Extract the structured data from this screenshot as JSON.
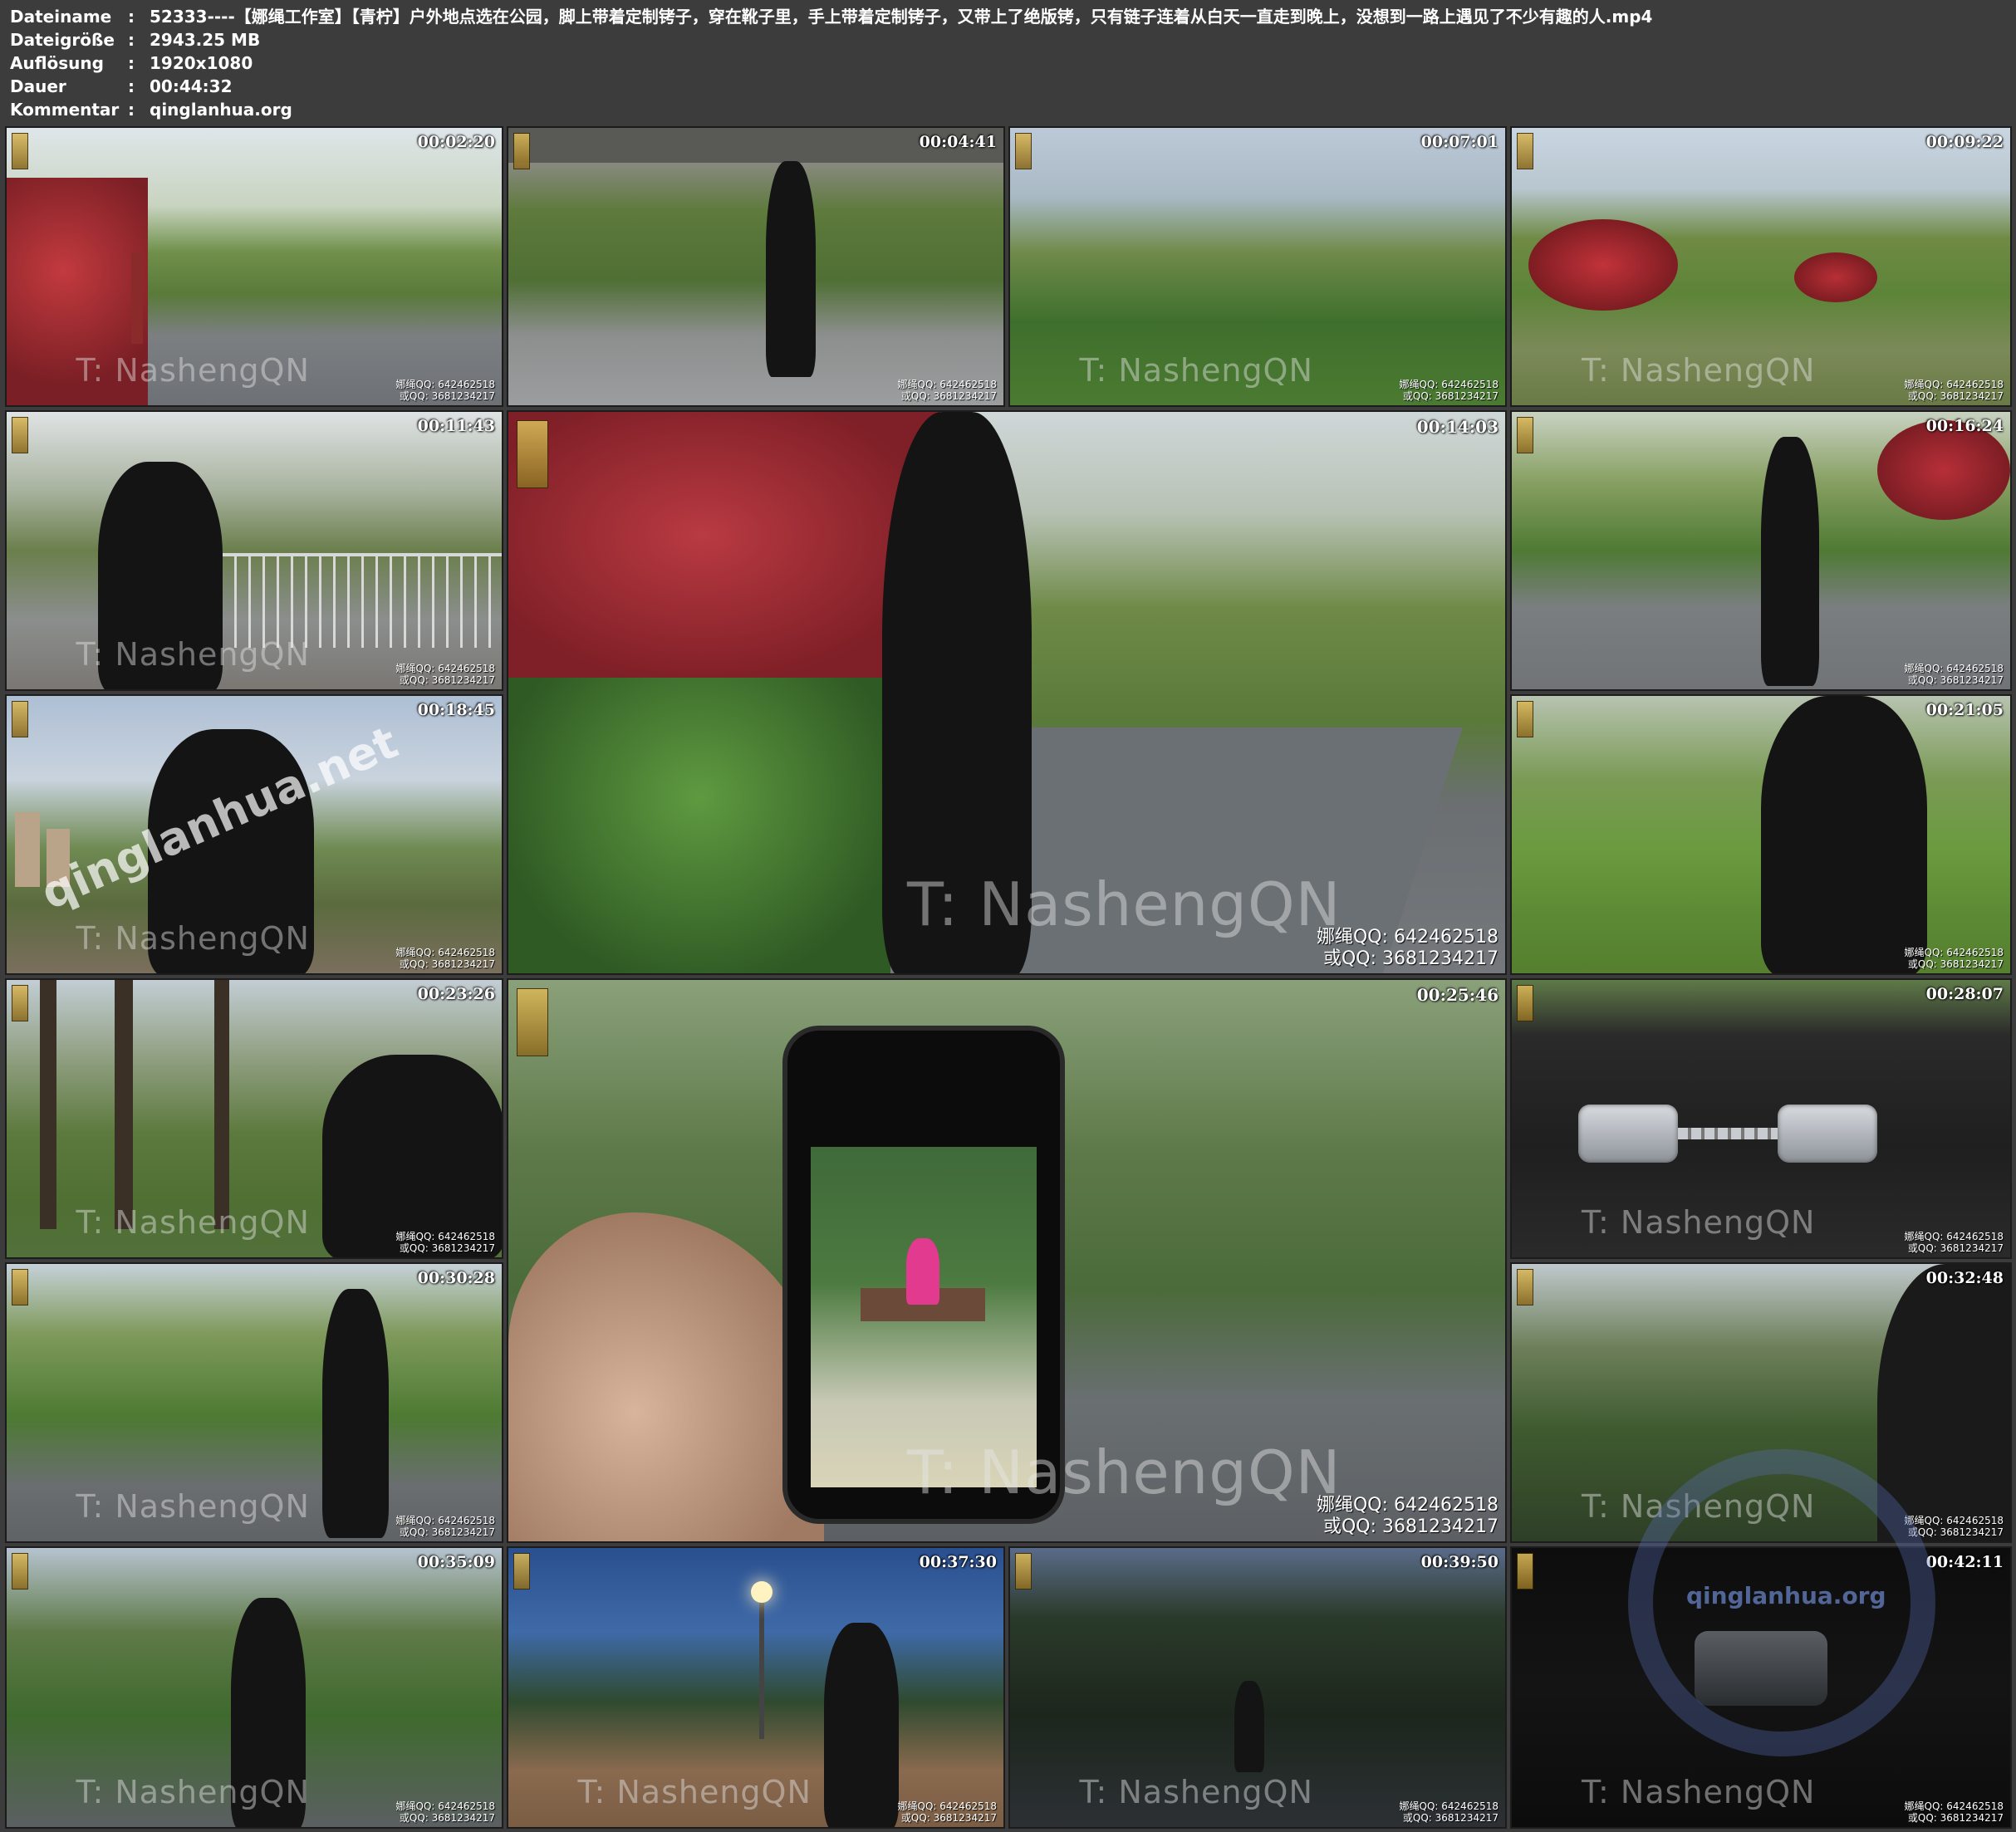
{
  "meta": {
    "rows": [
      {
        "key": "Dateiname",
        "value": "52333----【娜绳工作室】【青柠】户外地点选在公园，脚上带着定制铐子，穿在靴子里，手上带着定制铐子，又带上了绝版铐，只有链子连着从白天一直走到晚上，没想到一路上遇见了不少有趣的人.mp4"
      },
      {
        "key": "Dateigröße",
        "value": "2943.25 MB"
      },
      {
        "key": "Auflösung",
        "value": "1920x1080"
      },
      {
        "key": "Dauer",
        "value": "00:44:32"
      },
      {
        "key": "Kommentar",
        "value": "qinglanhua.org"
      }
    ],
    "separator": ":"
  },
  "watermark": {
    "frame_text": "T: NashengQN",
    "qq_line1": "娜绳QQ: 642462518",
    "qq_line2": "或QQ: 3681234217",
    "site_text": "qinglanhua.net",
    "corner_text": "qinglanhua.org"
  },
  "frames": [
    {
      "id": "f01",
      "timestamp": "00:02:20",
      "scene": "park-path-red-shrubs"
    },
    {
      "id": "f02",
      "timestamp": "00:04:41",
      "scene": "woman-under-bridge"
    },
    {
      "id": "f03",
      "timestamp": "00:07:01",
      "scene": "blurred-hillside"
    },
    {
      "id": "f04",
      "timestamp": "00:09:22",
      "scene": "park-lawn-red-shrubs"
    },
    {
      "id": "f05",
      "timestamp": "00:11:43",
      "scene": "woman-by-railing"
    },
    {
      "id": "f06",
      "timestamp": "00:14:03",
      "scene": "woman-walking-path-large"
    },
    {
      "id": "f07",
      "timestamp": "00:16:24",
      "scene": "woman-standing-path"
    },
    {
      "id": "f08",
      "timestamp": "00:18:45",
      "scene": "woman-closeup-trees"
    },
    {
      "id": "f09",
      "timestamp": "00:21:05",
      "scene": "woman-meadow"
    },
    {
      "id": "f10",
      "timestamp": "00:23:26",
      "scene": "woman-back-woods"
    },
    {
      "id": "f11",
      "timestamp": "00:25:46",
      "scene": "phone-in-hand-large"
    },
    {
      "id": "f12",
      "timestamp": "00:28:07",
      "scene": "handcuffs-closeup"
    },
    {
      "id": "f13",
      "timestamp": "00:30:28",
      "scene": "woman-path-greenery"
    },
    {
      "id": "f14",
      "timestamp": "00:32:48",
      "scene": "dusk-woods"
    },
    {
      "id": "f15",
      "timestamp": "00:35:09",
      "scene": "woman-dusk-path"
    },
    {
      "id": "f16",
      "timestamp": "00:37:30",
      "scene": "woman-streetlight-boardwalk"
    },
    {
      "id": "f17",
      "timestamp": "00:39:50",
      "scene": "night-path-figure"
    },
    {
      "id": "f18",
      "timestamp": "00:42:11",
      "scene": "dark-cuffs-closeup"
    }
  ],
  "colors": {
    "background": "#3c3c3c",
    "text": "#ffffff",
    "foliage": "#4f7a3a",
    "red_shrub": "#b0323a",
    "sky": "#c9d6e2",
    "path": "#6f747a"
  }
}
